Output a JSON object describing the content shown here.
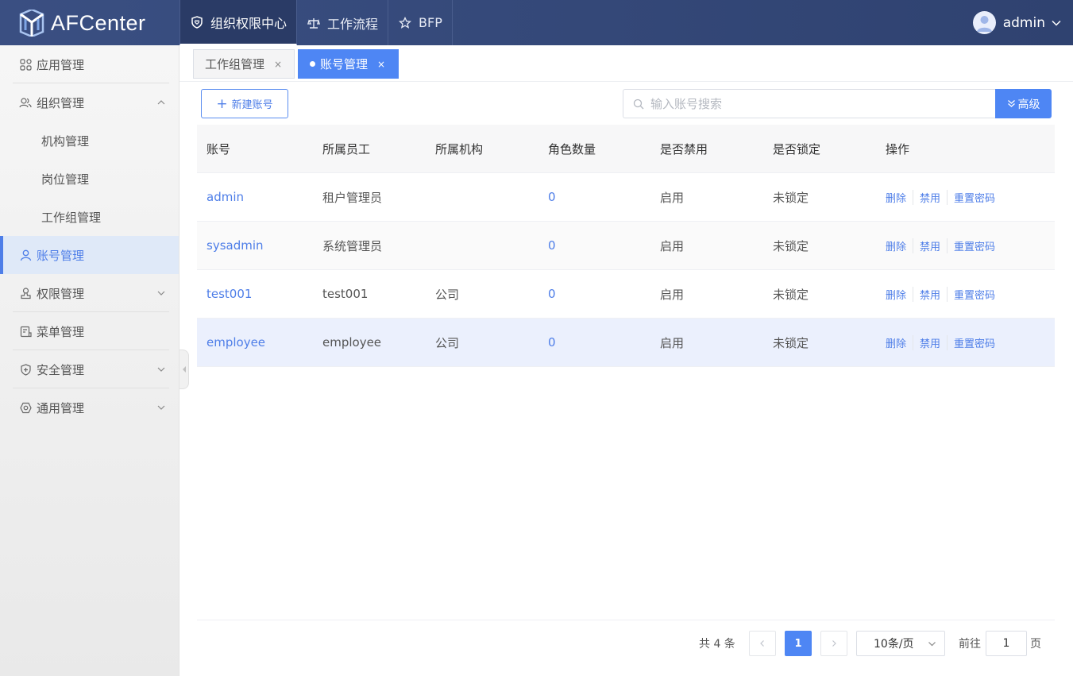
{
  "app": {
    "name": "AFCenter"
  },
  "topnav": [
    {
      "label": "组织权限中心",
      "icon": "shield-heart-icon",
      "active": true
    },
    {
      "label": "工作流程",
      "icon": "scale-icon",
      "active": false
    },
    {
      "label": "BFP",
      "icon": "star-icon",
      "active": false
    }
  ],
  "user": {
    "name": "admin"
  },
  "sidebar": {
    "items": [
      {
        "label": "应用管理",
        "icon": "grid-icon"
      },
      {
        "label": "组织管理",
        "icon": "users-icon"
      },
      {
        "label": "机构管理"
      },
      {
        "label": "岗位管理"
      },
      {
        "label": "工作组管理"
      },
      {
        "label": "账号管理",
        "icon": "user-icon"
      },
      {
        "label": "权限管理",
        "icon": "stamp-icon"
      },
      {
        "label": "菜单管理",
        "icon": "menu-doc-icon"
      },
      {
        "label": "安全管理",
        "icon": "shield-plus-icon"
      },
      {
        "label": "通用管理",
        "icon": "hex-gear-icon"
      }
    ]
  },
  "tabs": [
    {
      "label": "工作组管理",
      "close": "×"
    },
    {
      "label": "账号管理",
      "close": "×"
    }
  ],
  "toolbar": {
    "new_label": "新建账号",
    "search_placeholder": "输入账号搜索",
    "advanced_label": "高级"
  },
  "table": {
    "columns": [
      "账号",
      "所属员工",
      "所属机构",
      "角色数量",
      "是否禁用",
      "是否锁定",
      "操作"
    ],
    "rows": [
      {
        "account": "admin",
        "employee": "租户管理员",
        "org": "",
        "roles": "0",
        "disabled": "启用",
        "locked": "未锁定"
      },
      {
        "account": "sysadmin",
        "employee": "系统管理员",
        "org": "",
        "roles": "0",
        "disabled": "启用",
        "locked": "未锁定"
      },
      {
        "account": "test001",
        "employee": "test001",
        "org": "公司",
        "roles": "0",
        "disabled": "启用",
        "locked": "未锁定"
      },
      {
        "account": "employee",
        "employee": "employee",
        "org": "公司",
        "roles": "0",
        "disabled": "启用",
        "locked": "未锁定"
      }
    ],
    "actions": {
      "delete": "删除",
      "disable": "禁用",
      "reset": "重置密码"
    }
  },
  "pagination": {
    "total_text": "共 4 条",
    "current_page": "1",
    "page_size": "10条/页",
    "goto_prefix": "前往",
    "goto_value": "1",
    "goto_suffix": "页"
  },
  "colors": {
    "primary": "#4e86f4",
    "header": "#34487a",
    "link": "#4e7ee8"
  }
}
